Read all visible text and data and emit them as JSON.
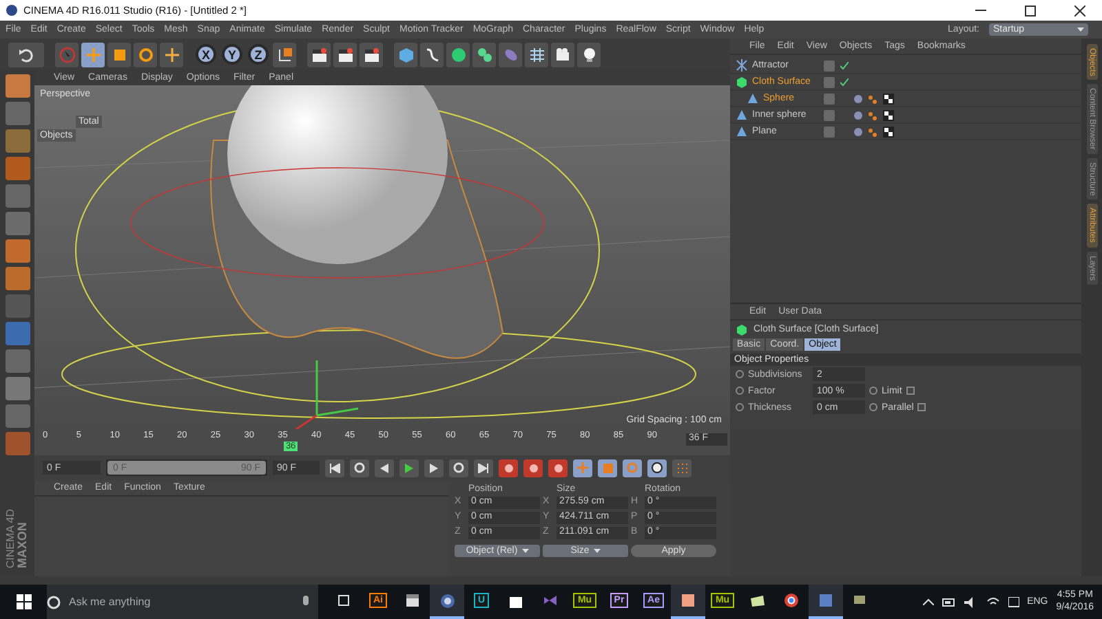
{
  "window": {
    "title": "CINEMA 4D R16.011 Studio (R16) - [Untitled 2 *]"
  },
  "menu": [
    "File",
    "Edit",
    "Create",
    "Select",
    "Tools",
    "Mesh",
    "Snap",
    "Animate",
    "Simulate",
    "Render",
    "Sculpt",
    "Motion Tracker",
    "MoGraph",
    "Character",
    "Plugins",
    "RealFlow",
    "Script",
    "Window",
    "Help"
  ],
  "layout": {
    "label": "Layout:",
    "value": "Startup"
  },
  "toolbar": [
    {
      "kind": "undo",
      "selected": false
    },
    {
      "kind": "select",
      "selected": false
    },
    {
      "kind": "move",
      "selected": true
    },
    {
      "kind": "scale",
      "selected": false
    },
    {
      "kind": "rotate",
      "selected": false
    },
    {
      "kind": "add",
      "selected": false
    },
    {
      "kind": "axis",
      "label": "X",
      "selected": true
    },
    {
      "kind": "axis",
      "label": "Y",
      "selected": true
    },
    {
      "kind": "axis",
      "label": "Z",
      "selected": true
    },
    {
      "kind": "coord",
      "selected": false
    },
    {
      "kind": "render",
      "selected": false
    },
    {
      "kind": "render",
      "selected": false
    },
    {
      "kind": "render",
      "selected": false
    },
    {
      "kind": "cube",
      "selected": false
    },
    {
      "kind": "pen",
      "selected": false
    },
    {
      "kind": "subdiv",
      "selected": false
    },
    {
      "kind": "array",
      "selected": false
    },
    {
      "kind": "deformer",
      "selected": false
    },
    {
      "kind": "floor",
      "selected": false
    },
    {
      "kind": "camera",
      "selected": false
    },
    {
      "kind": "light",
      "selected": false
    }
  ],
  "brand": [
    "MAXON",
    "CINEMA 4D"
  ],
  "viewport": {
    "menu": [
      "View",
      "Cameras",
      "Display",
      "Options",
      "Filter",
      "Panel"
    ],
    "camera": "Perspective",
    "hud": [
      "Total",
      "Objects"
    ],
    "grid_spacing": "Grid Spacing : 100 cm"
  },
  "timeline": {
    "ticks": [
      "0",
      "5",
      "10",
      "15",
      "20",
      "25",
      "30",
      "35",
      "40",
      "45",
      "50",
      "55",
      "60",
      "65",
      "70",
      "75",
      "80",
      "85",
      "90"
    ],
    "current": {
      "label": "36",
      "level": 0.4
    },
    "frame": "36 F"
  },
  "transport": {
    "start": "0 F",
    "range": {
      "start": "0 F",
      "end": "90 F",
      "level": 1
    },
    "end": "90 F"
  },
  "materials": {
    "menu": [
      "Create",
      "Edit",
      "Function",
      "Texture"
    ]
  },
  "coordinates": {
    "headers": [
      "Position",
      "Size",
      "Rotation"
    ],
    "rows": [
      {
        "axis": "X",
        "position": "0 cm",
        "size_axis": "X",
        "size": "275.59 cm",
        "rot_axis": "H",
        "rotation": "0 °"
      },
      {
        "axis": "Y",
        "position": "0 cm",
        "size_axis": "Y",
        "size": "424.711 cm",
        "rot_axis": "P",
        "rotation": "0 °"
      },
      {
        "axis": "Z",
        "position": "0 cm",
        "size_axis": "Z",
        "size": "211.091 cm",
        "rot_axis": "B",
        "rotation": "0 °"
      }
    ],
    "mode": "Object (Rel)",
    "size_mode": "Size",
    "apply": "Apply"
  },
  "object_manager": {
    "menu": [
      "File",
      "Edit",
      "View",
      "Objects",
      "Tags",
      "Bookmarks"
    ],
    "objects": [
      {
        "name": "Attractor",
        "kind": "attractor",
        "selected": false,
        "enabled": true,
        "tags": false
      },
      {
        "name": "Cloth Surface",
        "kind": "cloth",
        "selected": true,
        "enabled": true,
        "tags": false,
        "children": [
          {
            "name": "Sphere",
            "kind": "polygon",
            "selected": true,
            "enabled": false,
            "tags": true
          }
        ]
      },
      {
        "name": "Inner sphere",
        "kind": "polygon",
        "selected": false,
        "enabled": false,
        "tags": true
      },
      {
        "name": "Plane",
        "kind": "polygon",
        "selected": false,
        "enabled": false,
        "tags": true
      }
    ]
  },
  "attributes": {
    "menu": [
      "Edit",
      "User Data"
    ],
    "title": "Cloth Surface [Cloth Surface]",
    "tabs": [
      {
        "label": "Basic",
        "selected": false
      },
      {
        "label": "Coord.",
        "selected": false
      },
      {
        "label": "Object",
        "selected": true
      }
    ],
    "section": "Object Properties",
    "fields": [
      {
        "label": "Subdivisions",
        "value": "2"
      },
      {
        "label": "Factor",
        "value": "100 %"
      },
      {
        "label": "Thickness",
        "value": "0 cm"
      }
    ],
    "options": [
      {
        "label": "Limit",
        "checked": false
      },
      {
        "label": "Parallel",
        "checked": false
      }
    ]
  },
  "side_tabs": [
    {
      "label": "Objects",
      "selected": true
    },
    {
      "label": "Content Browser",
      "selected": false
    },
    {
      "label": "Structure",
      "selected": false
    },
    {
      "label": "Attributes",
      "selected": true
    },
    {
      "label": "Layers",
      "selected": false
    }
  ],
  "taskbar": {
    "search": "Ask me anything",
    "apps": [
      {
        "kind": "taskview",
        "active": false
      },
      {
        "kind": "text",
        "label": "Ai",
        "color": "#ff7c00",
        "active": false
      },
      {
        "kind": "clapper",
        "active": false
      },
      {
        "kind": "cinema",
        "active": true
      },
      {
        "kind": "text",
        "label": "U",
        "color": "#19b5c7",
        "active": false
      },
      {
        "kind": "store",
        "active": false
      },
      {
        "kind": "vs",
        "active": false
      },
      {
        "kind": "text",
        "label": "Mu",
        "color": "#a4c400",
        "active": false
      },
      {
        "kind": "text",
        "label": "Pr",
        "color": "#c49dff",
        "active": false
      },
      {
        "kind": "text",
        "label": "Ae",
        "color": "#a69eff",
        "active": false
      },
      {
        "kind": "doc",
        "active": true
      },
      {
        "kind": "text",
        "label": "Mu",
        "color": "#a4c400",
        "active": false
      },
      {
        "kind": "notes",
        "active": false
      },
      {
        "kind": "chrome",
        "active": false
      },
      {
        "kind": "word",
        "active": true
      },
      {
        "kind": "pc",
        "active": false
      }
    ],
    "language": "ENG",
    "time": "4:55 PM",
    "date": "9/4/2016"
  }
}
